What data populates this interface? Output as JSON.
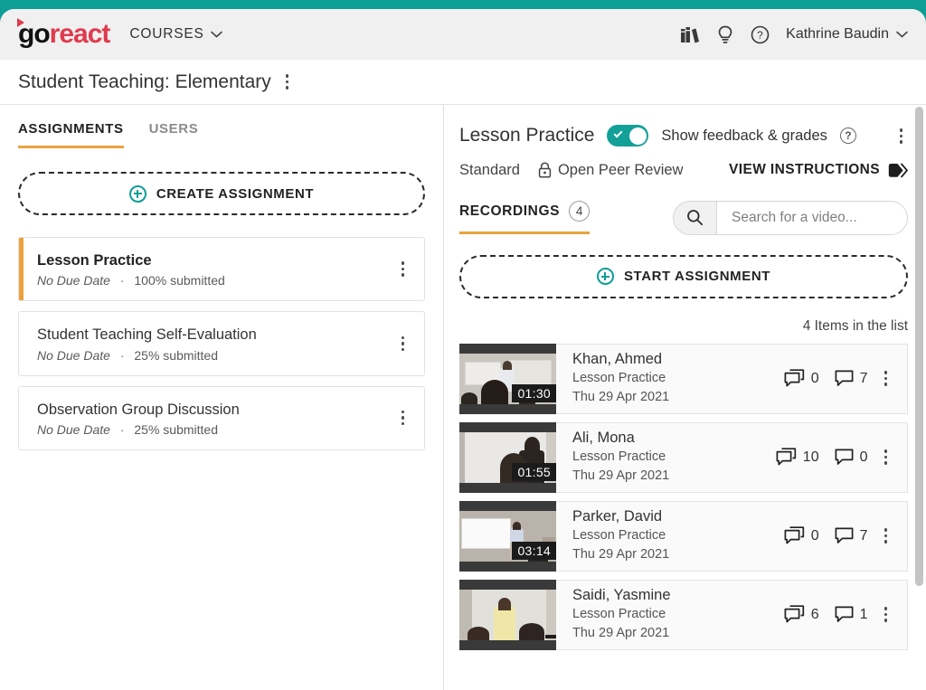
{
  "brand": {
    "logo_go": "go",
    "logo_react": "react",
    "teal": "#0d9e96",
    "red": "#e03a4e",
    "amber": "#e8a33d"
  },
  "header": {
    "courses_label": "COURSES",
    "icons": [
      "books-icon",
      "lightbulb-icon",
      "help-circle-icon"
    ],
    "user_name": "Kathrine Baudin"
  },
  "course": {
    "title": "Student Teaching: Elementary"
  },
  "left_panel": {
    "tabs": [
      {
        "label": "ASSIGNMENTS",
        "active": true
      },
      {
        "label": "USERS",
        "active": false
      }
    ],
    "create_button": "CREATE ASSIGNMENT",
    "assignments": [
      {
        "name": "Lesson Practice",
        "due": "No Due Date",
        "submitted": "100% submitted",
        "active": true
      },
      {
        "name": "Student Teaching Self-Evaluation",
        "due": "No Due Date",
        "submitted": "25% submitted",
        "active": false
      },
      {
        "name": "Observation Group Discussion",
        "due": "No Due Date",
        "submitted": "25% submitted",
        "active": false
      }
    ],
    "separator": "·"
  },
  "right_panel": {
    "title": "Lesson Practice",
    "toggle_on": true,
    "toggle_label": "Show feedback & grades",
    "meta": {
      "standard": "Standard",
      "peer_review": "Open Peer Review",
      "view_instructions": "VIEW INSTRUCTIONS"
    },
    "recordings_tab": "RECORDINGS",
    "recordings_count": "4",
    "search_placeholder": "Search for a video...",
    "search_value": "",
    "start_button": "START ASSIGNMENT",
    "items_count": "4 Items in the list",
    "videos": [
      {
        "name": "Khan, Ahmed",
        "assignment": "Lesson Practice",
        "date": "Thu 29 Apr 2021",
        "duration": "01:30",
        "group_comments": "0",
        "comments": "7"
      },
      {
        "name": "Ali, Mona",
        "assignment": "Lesson Practice",
        "date": "Thu 29 Apr 2021",
        "duration": "01:55",
        "group_comments": "10",
        "comments": "0"
      },
      {
        "name": "Parker, David",
        "assignment": "Lesson Practice",
        "date": "Thu 29 Apr 2021",
        "duration": "03:14",
        "group_comments": "0",
        "comments": "7"
      },
      {
        "name": "Saidi, Yasmine",
        "assignment": "Lesson Practice",
        "date": "Thu 29 Apr 2021",
        "duration": "",
        "group_comments": "6",
        "comments": "1"
      }
    ]
  }
}
